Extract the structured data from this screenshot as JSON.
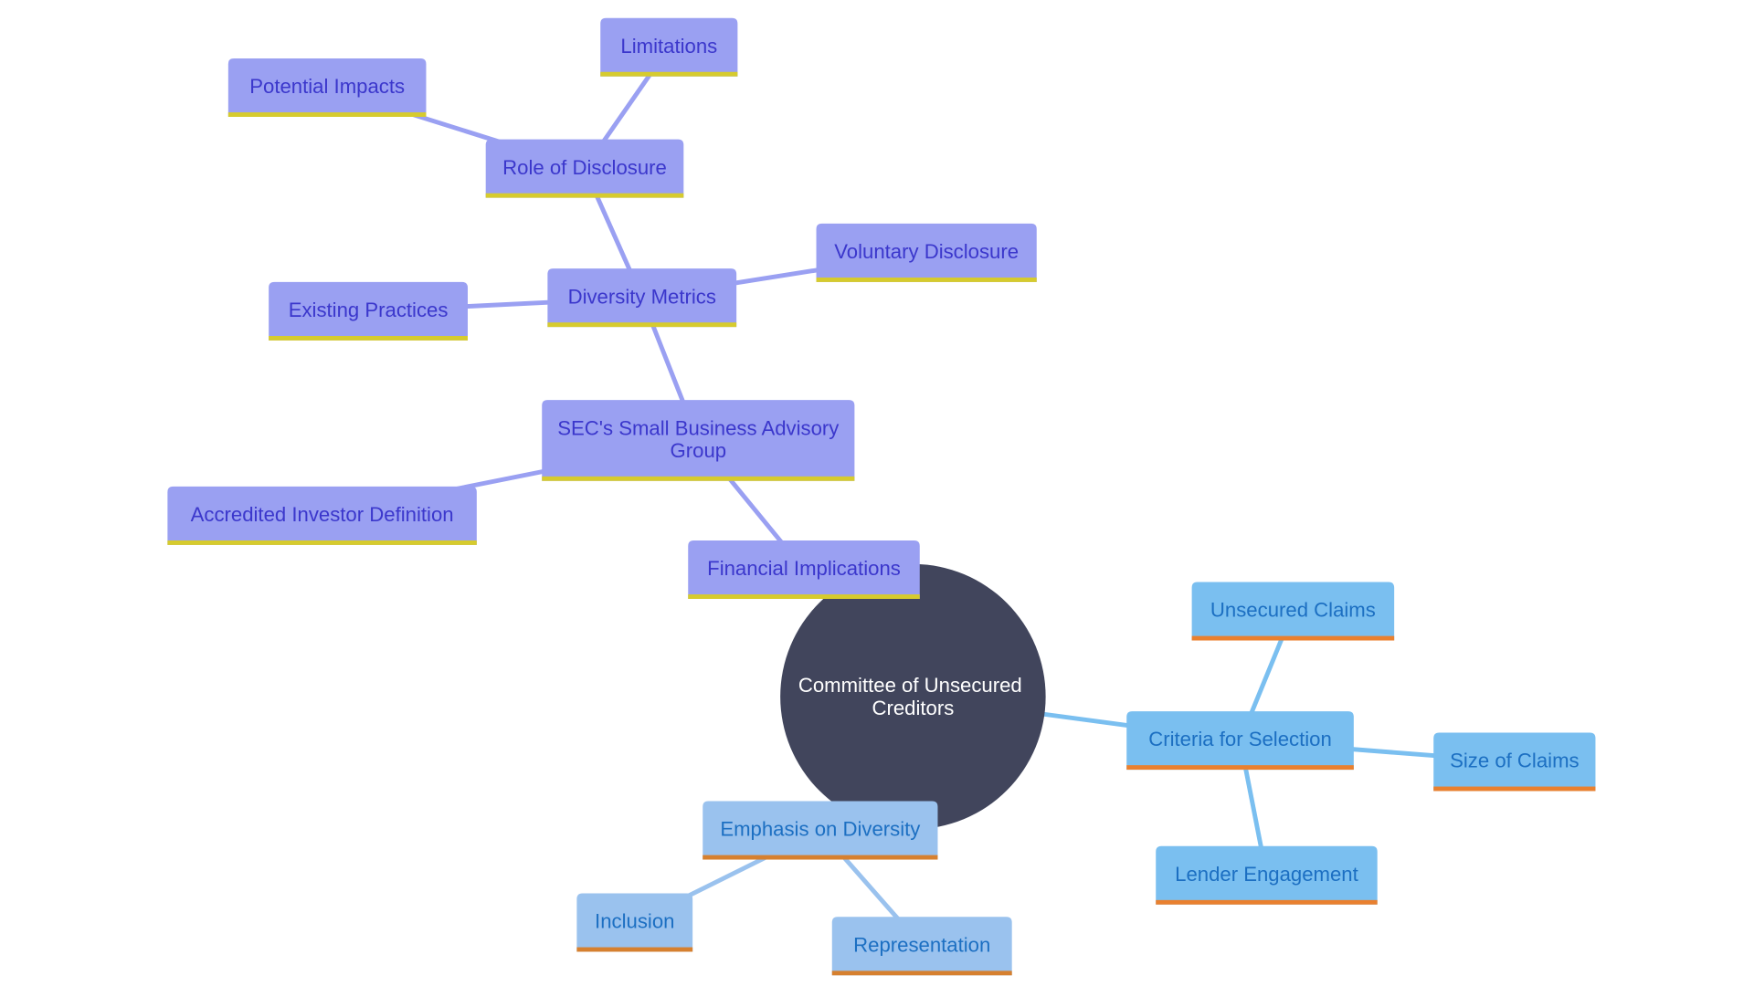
{
  "diagram": {
    "type": "mindmap",
    "root": {
      "id": "root",
      "lines": [
        "Committee of Unsecured",
        "Creditors"
      ],
      "color": "#41455C",
      "text_color": "#FFFFFF"
    },
    "palettes": {
      "violet": {
        "fill": "#9AA0F2",
        "text": "#3B37CC",
        "underline": "#D6CB2E",
        "edge": "#9AA0F2"
      },
      "blue": {
        "fill": "#7ABFF0",
        "text": "#1C6FC2",
        "underline": "#E9802F",
        "edge": "#7ABFF0"
      },
      "lightblue": {
        "fill": "#9AC2EE",
        "text": "#1C6FC2",
        "underline": "#D6802F",
        "edge": "#9AC2EE"
      }
    },
    "nodes": [
      {
        "id": "financial-implications",
        "lines": [
          "Financial Implications"
        ],
        "palette": "violet",
        "parent": "root"
      },
      {
        "id": "secs-small-business-advisory-group",
        "lines": [
          "SEC's Small Business Advisory",
          "Group"
        ],
        "palette": "violet",
        "parent": "financial-implications"
      },
      {
        "id": "accredited-investor-definition",
        "lines": [
          "Accredited Investor Definition"
        ],
        "palette": "violet",
        "parent": "secs-small-business-advisory-group"
      },
      {
        "id": "diversity-metrics",
        "lines": [
          "Diversity Metrics"
        ],
        "palette": "violet",
        "parent": "secs-small-business-advisory-group"
      },
      {
        "id": "existing-practices",
        "lines": [
          "Existing Practices"
        ],
        "palette": "violet",
        "parent": "diversity-metrics"
      },
      {
        "id": "voluntary-disclosure",
        "lines": [
          "Voluntary Disclosure"
        ],
        "palette": "violet",
        "parent": "diversity-metrics"
      },
      {
        "id": "role-of-disclosure",
        "lines": [
          "Role of Disclosure"
        ],
        "palette": "violet",
        "parent": "diversity-metrics"
      },
      {
        "id": "potential-impacts",
        "lines": [
          "Potential Impacts"
        ],
        "palette": "violet",
        "parent": "role-of-disclosure"
      },
      {
        "id": "limitations",
        "lines": [
          "Limitations"
        ],
        "palette": "violet",
        "parent": "role-of-disclosure"
      },
      {
        "id": "criteria-for-selection",
        "lines": [
          "Criteria for Selection"
        ],
        "palette": "blue",
        "parent": "root"
      },
      {
        "id": "unsecured-claims",
        "lines": [
          "Unsecured Claims"
        ],
        "palette": "blue",
        "parent": "criteria-for-selection"
      },
      {
        "id": "size-of-claims",
        "lines": [
          "Size of Claims"
        ],
        "palette": "blue",
        "parent": "criteria-for-selection"
      },
      {
        "id": "lender-engagement",
        "lines": [
          "Lender Engagement"
        ],
        "palette": "blue",
        "parent": "criteria-for-selection"
      },
      {
        "id": "emphasis-on-diversity",
        "lines": [
          "Emphasis on Diversity"
        ],
        "palette": "lightblue",
        "parent": "root"
      },
      {
        "id": "inclusion",
        "lines": [
          "Inclusion"
        ],
        "palette": "lightblue",
        "parent": "emphasis-on-diversity"
      },
      {
        "id": "representation",
        "lines": [
          "Representation"
        ],
        "palette": "lightblue",
        "parent": "emphasis-on-diversity"
      }
    ]
  }
}
